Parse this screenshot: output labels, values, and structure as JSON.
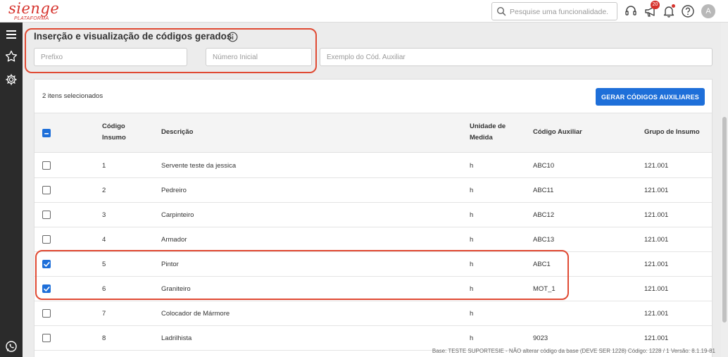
{
  "brand": {
    "name": "sienge",
    "subtitle": "PLATAFORMA"
  },
  "search": {
    "placeholder": "Pesquise uma funcionalidade."
  },
  "topbar": {
    "notifications_count": "20",
    "avatar_initial": "A"
  },
  "sidebar": {
    "icons": [
      "menu-icon",
      "star-icon",
      "gear-icon",
      "whatsapp-icon"
    ]
  },
  "section": {
    "title": "Inserção e visualização de códigos gerados",
    "prefix_placeholder": "Prefixo",
    "start_number_placeholder": "Número Inicial",
    "aux_example_placeholder": "Exemplo do Cód. Auxiliar"
  },
  "table": {
    "selected_text": "2 itens selecionados",
    "generate_button": "GERAR CÓDIGOS AUXILIARES",
    "columns": {
      "code": "Código Insumo",
      "description": "Descrição",
      "unit": "Unidade de Medida",
      "aux_code": "Código Auxiliar",
      "group": "Grupo de Insumo"
    },
    "header_checkbox": "indeterminate",
    "rows": [
      {
        "checked": false,
        "code": "1",
        "description": "Servente teste da jessica",
        "unit": "h",
        "aux_code": "ABC10",
        "group": "121.001"
      },
      {
        "checked": false,
        "code": "2",
        "description": "Pedreiro",
        "unit": "h",
        "aux_code": "ABC11",
        "group": "121.001"
      },
      {
        "checked": false,
        "code": "3",
        "description": "Carpinteiro",
        "unit": "h",
        "aux_code": "ABC12",
        "group": "121.001"
      },
      {
        "checked": false,
        "code": "4",
        "description": "Armador",
        "unit": "h",
        "aux_code": "ABC13",
        "group": "121.001"
      },
      {
        "checked": true,
        "code": "5",
        "description": "Pintor",
        "unit": "h",
        "aux_code": "ABC1",
        "group": "121.001"
      },
      {
        "checked": true,
        "code": "6",
        "description": "Graniteiro",
        "unit": "h",
        "aux_code": "MOT_1",
        "group": "121.001"
      },
      {
        "checked": false,
        "code": "7",
        "description": "Colocador de Mármore",
        "unit": "h",
        "aux_code": "",
        "group": "121.001"
      },
      {
        "checked": false,
        "code": "8",
        "description": "Ladrilhista",
        "unit": "h",
        "aux_code": "9023",
        "group": "121.001"
      }
    ]
  },
  "footer": {
    "text": "Base: TESTE SUPORTESIE - NÃO alterar código da base (DEVE SER 1228)  Código: 1228 / 1  Versão: 8.1.19-81"
  },
  "colors": {
    "brand": "#d6322c",
    "primary": "#1e6fd9",
    "highlight": "#e04a33",
    "sidebar": "#2b2b2b"
  }
}
